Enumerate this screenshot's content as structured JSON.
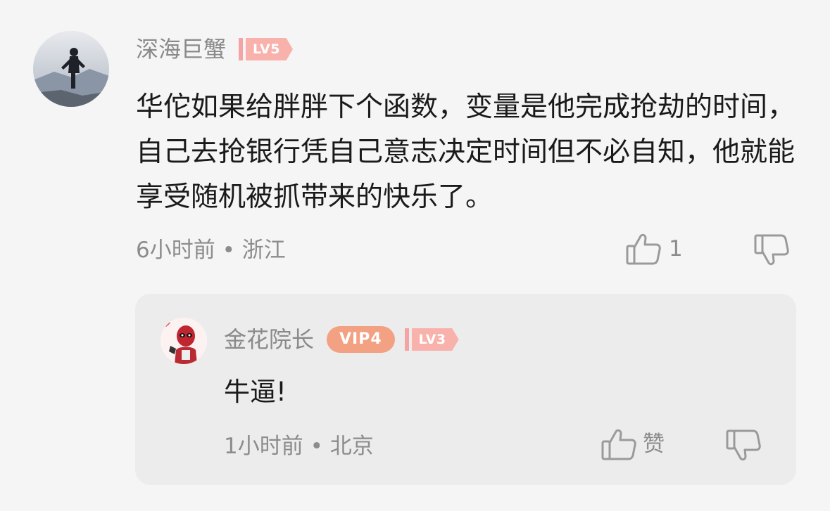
{
  "comment": {
    "username": "深海巨蟹",
    "level": "LV5",
    "text": "华佗如果给胖胖下个函数，变量是他完成抢劫的时间，自己去抢银行凭自己意志决定时间但不必自知，他就能享受随机被抓带来的快乐了。",
    "meta": "6小时前 • 浙江",
    "like_count": "1",
    "icons": {
      "avatar": "user-avatar",
      "like": "thumbs-up-icon",
      "dislike": "thumbs-down-icon"
    }
  },
  "reply": {
    "username": "金花院长",
    "vip": "VIP4",
    "level": "LV3",
    "text": "牛逼!",
    "meta": "1小时前 • 北京",
    "like_label": "赞",
    "icons": {
      "avatar": "deadpool-avatar",
      "like": "thumbs-up-icon",
      "dislike": "thumbs-down-icon"
    }
  },
  "colors": {
    "background": "#f5f5f5",
    "reply_background": "#ececec",
    "level_badge": "#f9b1ac",
    "vip_badge": "#f3a183",
    "muted_text": "#8c8c8c"
  }
}
